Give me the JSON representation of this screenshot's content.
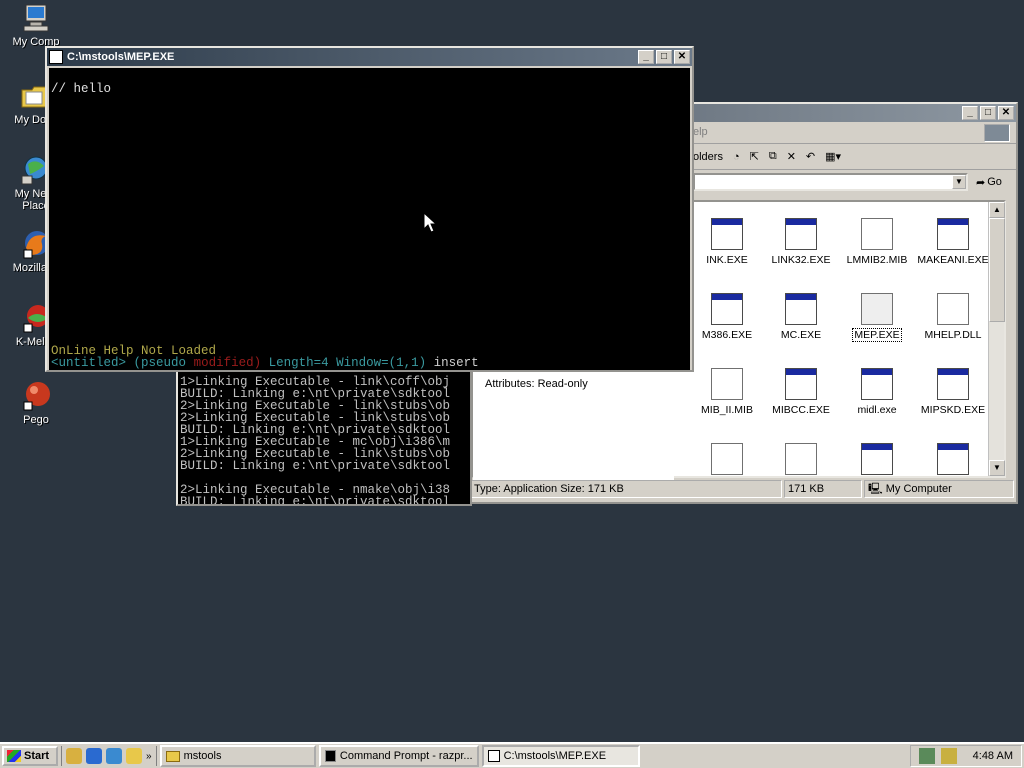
{
  "desktop": {
    "icons": [
      {
        "label": "My Computer"
      },
      {
        "label": "My Documents"
      },
      {
        "label": "My Network Places"
      },
      {
        "label": "Mozilla Firefox"
      },
      {
        "label": "K-Meleon"
      },
      {
        "label": "Pego"
      }
    ],
    "icon_labels_visible": [
      "My Comp",
      "My Docu",
      "My Netw\nPlace",
      "Mozilla Fi",
      "K-Melec",
      "Pego"
    ]
  },
  "mep_window": {
    "title": "C:\\mstools\\MEP.EXE",
    "editor_text": "// hello",
    "help_line": "OnLine Help Not Loaded",
    "status": {
      "file": "<untitled>",
      "mode": "(pseudo",
      "modified": "modified)",
      "length": "Length=4",
      "window": "Window=(1,1)",
      "insert": "insert"
    }
  },
  "explorer_window": {
    "menu_fragment": "elp",
    "toolbar": {
      "folders_label": "olders"
    },
    "go_label": "Go",
    "files": [
      {
        "name": "INK.EXE",
        "type": "exe"
      },
      {
        "name": "LINK32.EXE",
        "type": "exe"
      },
      {
        "name": "LMMIB2.MIB",
        "type": "doc"
      },
      {
        "name": "MAKEANI.EXE",
        "type": "exe"
      },
      {
        "name": "M386.EXE",
        "type": "exe"
      },
      {
        "name": "MC.EXE",
        "type": "exe"
      },
      {
        "name": "MEP.EXE",
        "type": "exe"
      },
      {
        "name": "MHELP.DLL",
        "type": "dll"
      },
      {
        "name": "MIB_II.MIB",
        "type": "doc"
      },
      {
        "name": "MIBCC.EXE",
        "type": "exe"
      },
      {
        "name": "midl.exe",
        "type": "exe"
      },
      {
        "name": "MIPSKD.EXE",
        "type": "exe"
      },
      {
        "name": "",
        "type": "doc"
      },
      {
        "name": "",
        "type": "doc"
      },
      {
        "name": "",
        "type": "exe"
      },
      {
        "name": "",
        "type": "exe"
      }
    ],
    "attributes": "Attributes: Read-only",
    "status": {
      "type_size": "Type: Application Size: 171 KB",
      "size": "171 KB",
      "location": "My Computer"
    }
  },
  "command_prompt": {
    "lines": [
      "1>Linking Executable - link\\coff\\obj",
      "BUILD: Linking e:\\nt\\private\\sdktool",
      "2>Linking Executable - link\\stubs\\ob",
      "2>Linking Executable - link\\stubs\\ob",
      "BUILD: Linking e:\\nt\\private\\sdktool",
      "1>Linking Executable - mc\\obj\\i386\\m",
      "2>Linking Executable - link\\stubs\\ob",
      "BUILD: Linking e:\\nt\\private\\sdktool",
      "",
      "2>Linking Executable - nmake\\obj\\i38",
      "BUILD: Linking e:\\nt\\private\\sdktool"
    ]
  },
  "taskbar": {
    "start_label": "Start",
    "tasks": [
      {
        "label": "mstools",
        "active": false
      },
      {
        "label": "Command Prompt - razpr...",
        "active": false
      },
      {
        "label": "C:\\mstools\\MEP.EXE",
        "active": true
      }
    ],
    "clock": "4:48 AM"
  }
}
